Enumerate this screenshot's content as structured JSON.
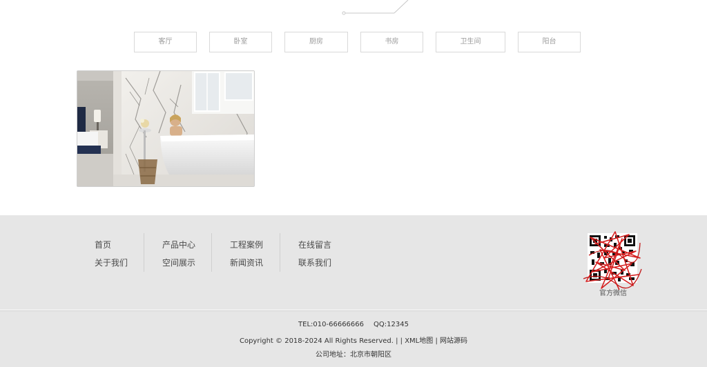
{
  "tabs": [
    {
      "label": "客厅"
    },
    {
      "label": "卧室"
    },
    {
      "label": "厨房"
    },
    {
      "label": "书房"
    },
    {
      "label": "卫生间"
    },
    {
      "label": "阳台"
    }
  ],
  "footer": {
    "nav_columns": [
      [
        "首页",
        "关于我们"
      ],
      [
        "产品中心",
        "空间展示"
      ],
      [
        "工程案例",
        "新闻资讯"
      ],
      [
        "在线留言",
        "联系我们"
      ]
    ],
    "qr_label": "官方微信",
    "tel": "TEL:010-66666666",
    "qq": "QQ:12345",
    "copyright": "Copyright © 2018-2024 All Rights Reserved. | |",
    "xml_map": "XML地图",
    "separator": "|",
    "source_link": "网站源码",
    "address": "公司地址：北京市朝阳区"
  },
  "colors": {
    "footer_bg": "#e6e6e6",
    "tab_border": "#d9d9d9",
    "tab_text": "#9a9a9a",
    "qr_scribble": "#d62020"
  }
}
